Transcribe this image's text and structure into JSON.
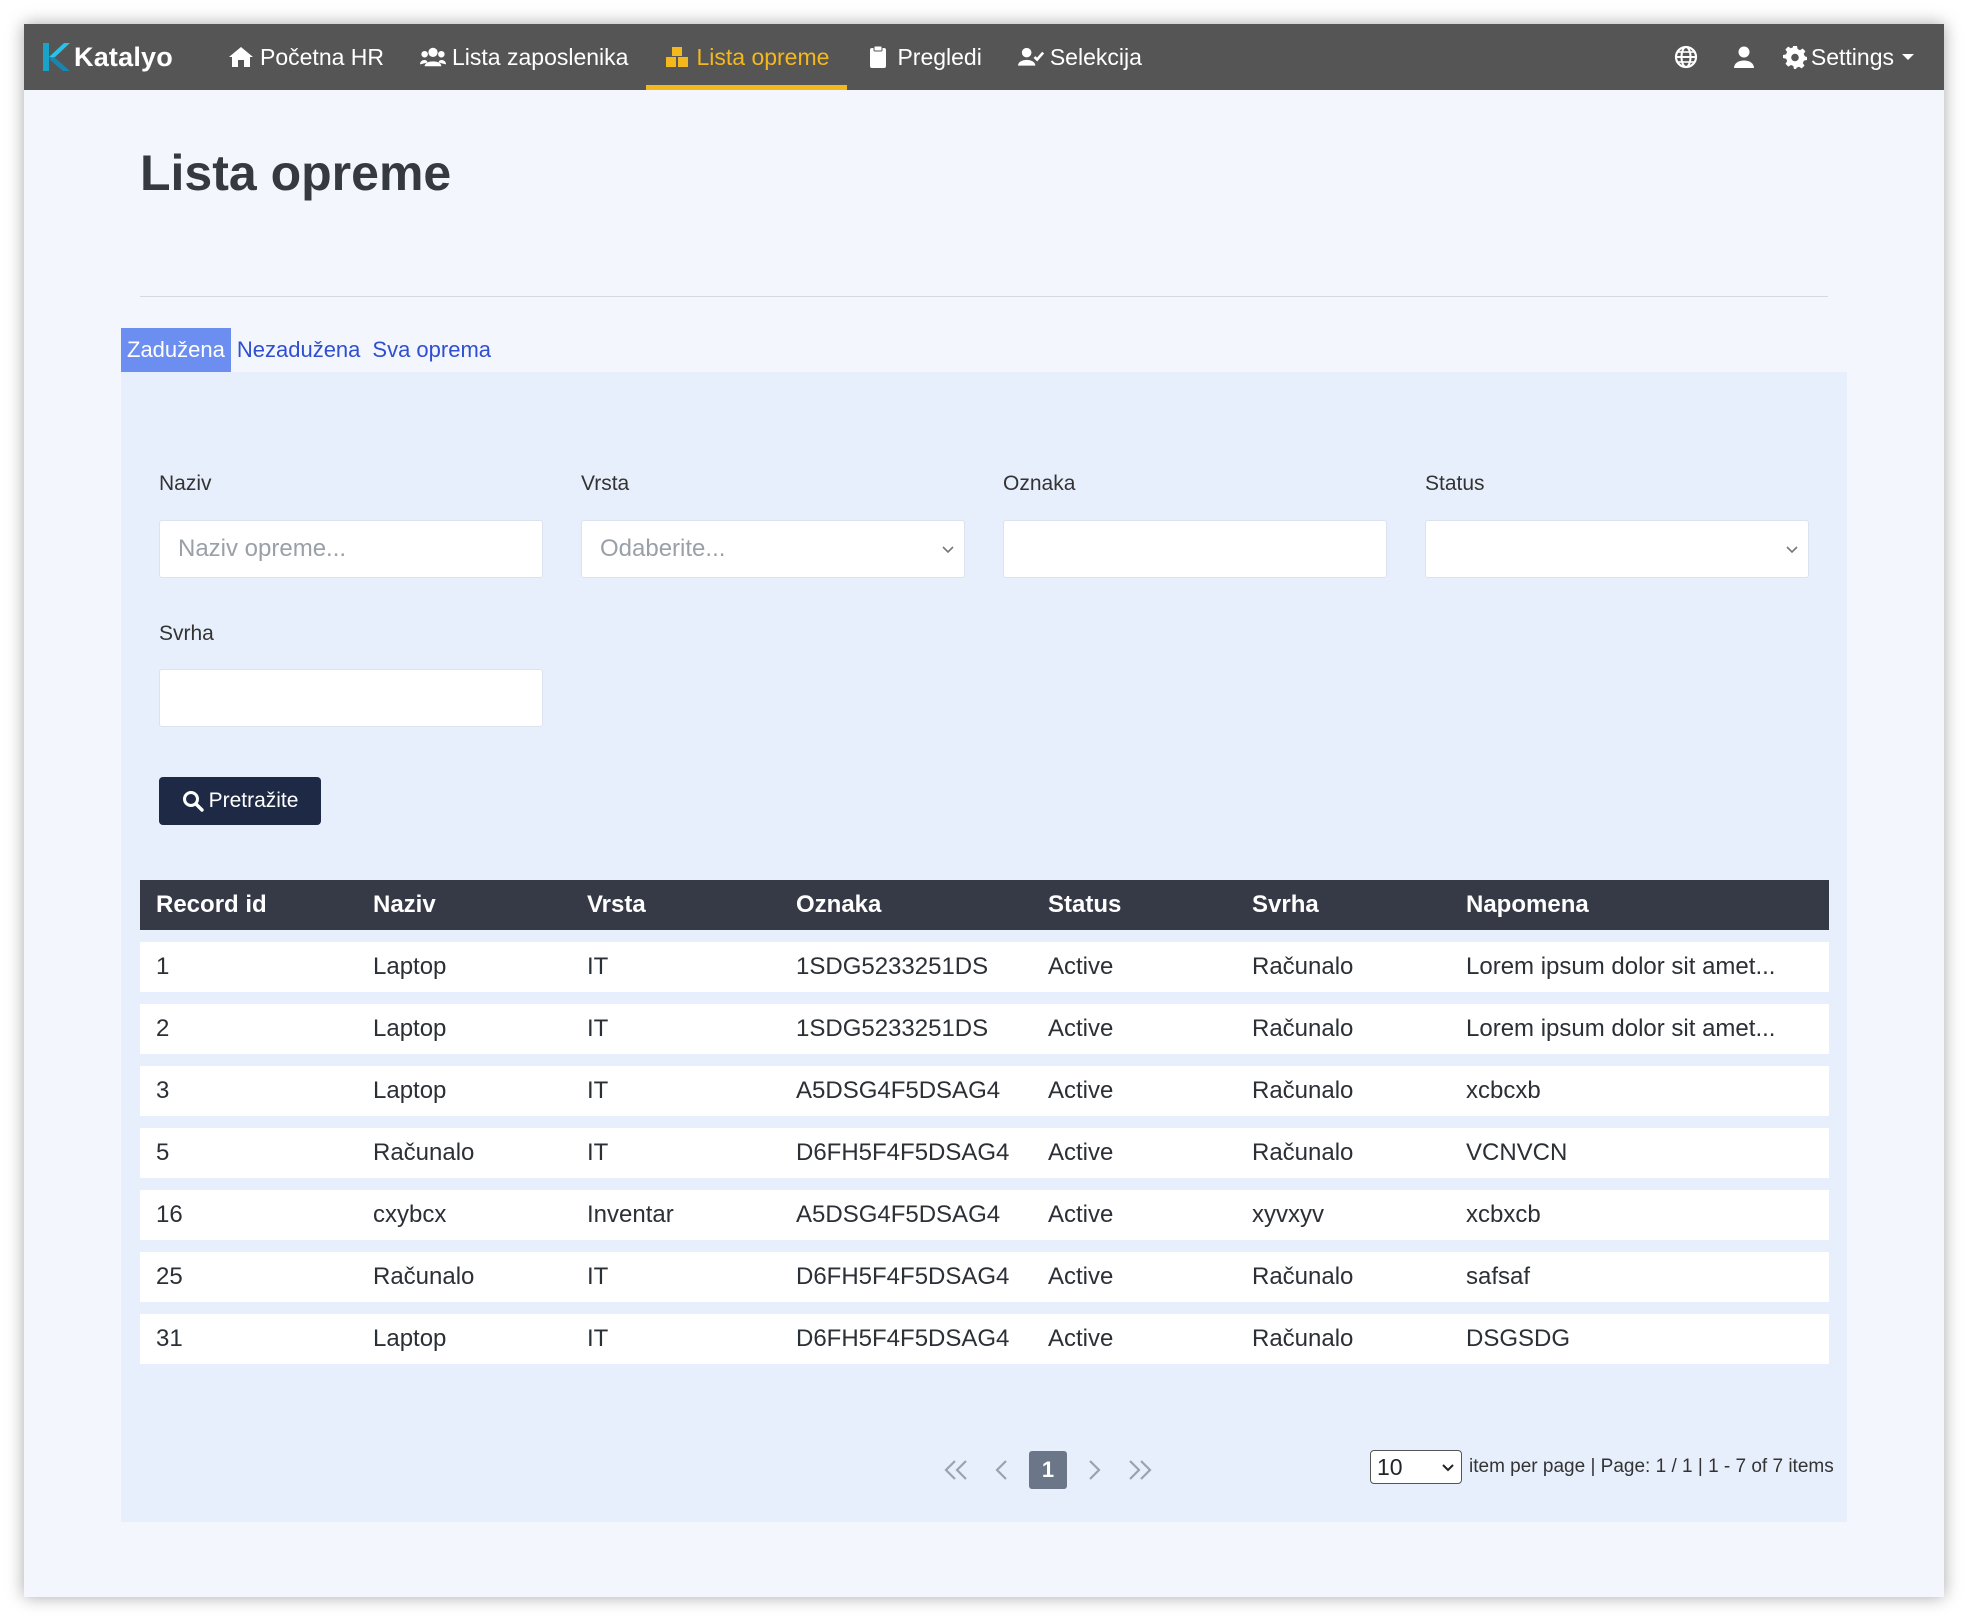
{
  "brand": {
    "name": "Katalyo"
  },
  "nav": {
    "items": [
      {
        "label": "Početna HR",
        "icon": "home-icon"
      },
      {
        "label": "Lista zaposlenika",
        "icon": "users-icon"
      },
      {
        "label": "Lista opreme",
        "icon": "boxes-icon",
        "active": true
      },
      {
        "label": "Pregledi",
        "icon": "clipboard-icon"
      },
      {
        "label": "Selekcija",
        "icon": "user-check-icon"
      }
    ],
    "settings_label": "Settings"
  },
  "page": {
    "title": "Lista opreme"
  },
  "tabs": [
    {
      "label": "Zadužena",
      "active": true
    },
    {
      "label": "Nezadužena"
    },
    {
      "label": "Sva oprema"
    }
  ],
  "filters": {
    "naziv": {
      "label": "Naziv",
      "placeholder": "Naziv opreme...",
      "value": ""
    },
    "vrsta": {
      "label": "Vrsta",
      "placeholder": "Odaberite..."
    },
    "oznaka": {
      "label": "Oznaka",
      "value": ""
    },
    "status": {
      "label": "Status",
      "value": ""
    },
    "svrha": {
      "label": "Svrha",
      "value": ""
    },
    "search_label": "Pretražite"
  },
  "table": {
    "headers": [
      "Record id",
      "Naziv",
      "Vrsta",
      "Oznaka",
      "Status",
      "Svrha",
      "Napomena"
    ],
    "rows": [
      [
        "1",
        "Laptop",
        "IT",
        "1SDG5233251DS",
        "Active",
        "Računalo",
        "Lorem ipsum dolor sit amet..."
      ],
      [
        "2",
        "Laptop",
        "IT",
        "1SDG5233251DS",
        "Active",
        "Računalo",
        "Lorem ipsum dolor sit amet..."
      ],
      [
        "3",
        "Laptop",
        "IT",
        "A5DSG4F5DSAG4",
        "Active",
        "Računalo",
        "xcbcxb"
      ],
      [
        "5",
        "Računalo",
        "IT",
        "D6FH5F4F5DSAG4",
        "Active",
        "Računalo",
        "VCNVCN"
      ],
      [
        "16",
        "cxybcx",
        "Inventar",
        "A5DSG4F5DSAG4",
        "Active",
        "xyvxyv",
        "xcbxcb"
      ],
      [
        "25",
        "Računalo",
        "IT",
        "D6FH5F4F5DSAG4",
        "Active",
        "Računalo",
        "safsaf"
      ],
      [
        "31",
        "Laptop",
        "IT",
        "D6FH5F4F5DSAG4",
        "Active",
        "Računalo",
        "DSGSDG"
      ]
    ]
  },
  "pagination": {
    "current_page": "1",
    "per_page": "10",
    "info": "item per page | Page: 1 / 1 | 1 - 7 of 7 items"
  },
  "colors": {
    "navbar": "#555555",
    "accent": "#f5b81c",
    "tab_active": "#6c8ef0",
    "table_header": "#353a46",
    "button": "#1e2a45"
  }
}
